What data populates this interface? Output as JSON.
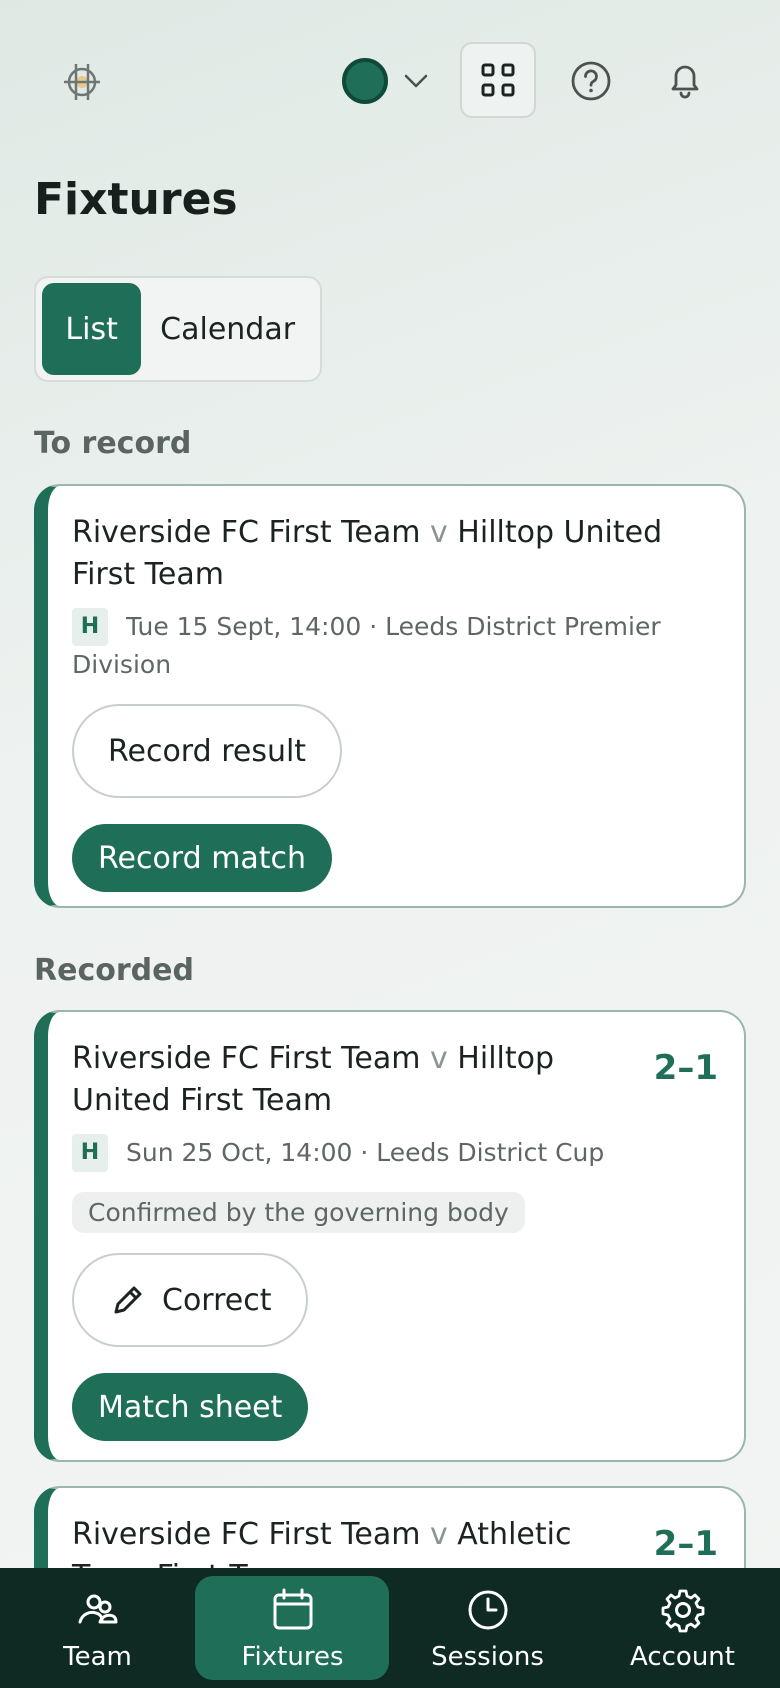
{
  "header": {
    "title": "Fixtures"
  },
  "view_toggle": {
    "list": "List",
    "calendar": "Calendar",
    "selected": "List"
  },
  "sections": {
    "to_record": "To record",
    "recorded": "Recorded"
  },
  "to_record_cards": [
    {
      "home": "Riverside FC First Team",
      "vs": "v",
      "away": "Hilltop United First Team",
      "venue_badge": "H",
      "meta": "Tue 15 Sept, 14:00 · Leeds District Premier Division",
      "record_result": "Record result",
      "record_match": "Record match"
    }
  ],
  "recorded_cards": [
    {
      "home": "Riverside FC First Team",
      "vs": "v",
      "away": "Hilltop United First Team",
      "score": "2–1",
      "venue_badge": "H",
      "meta": "Sun 25 Oct, 14:00 · Leeds District Cup",
      "status": "Confirmed by the governing body",
      "correct": "Correct",
      "match_sheet": "Match sheet"
    },
    {
      "home": "Riverside FC First Team",
      "vs": "v",
      "away": "Athletic Town First Team",
      "score": "2–1"
    }
  ],
  "bottom_nav": {
    "items": [
      {
        "label": "Team",
        "icon": "team-icon"
      },
      {
        "label": "Fixtures",
        "icon": "calendar-icon"
      },
      {
        "label": "Sessions",
        "icon": "clock-icon"
      },
      {
        "label": "Account",
        "icon": "gear-icon"
      }
    ],
    "active": "Fixtures"
  },
  "colors": {
    "brand": "#1f6e57",
    "nav_bg": "#0f2a22"
  }
}
